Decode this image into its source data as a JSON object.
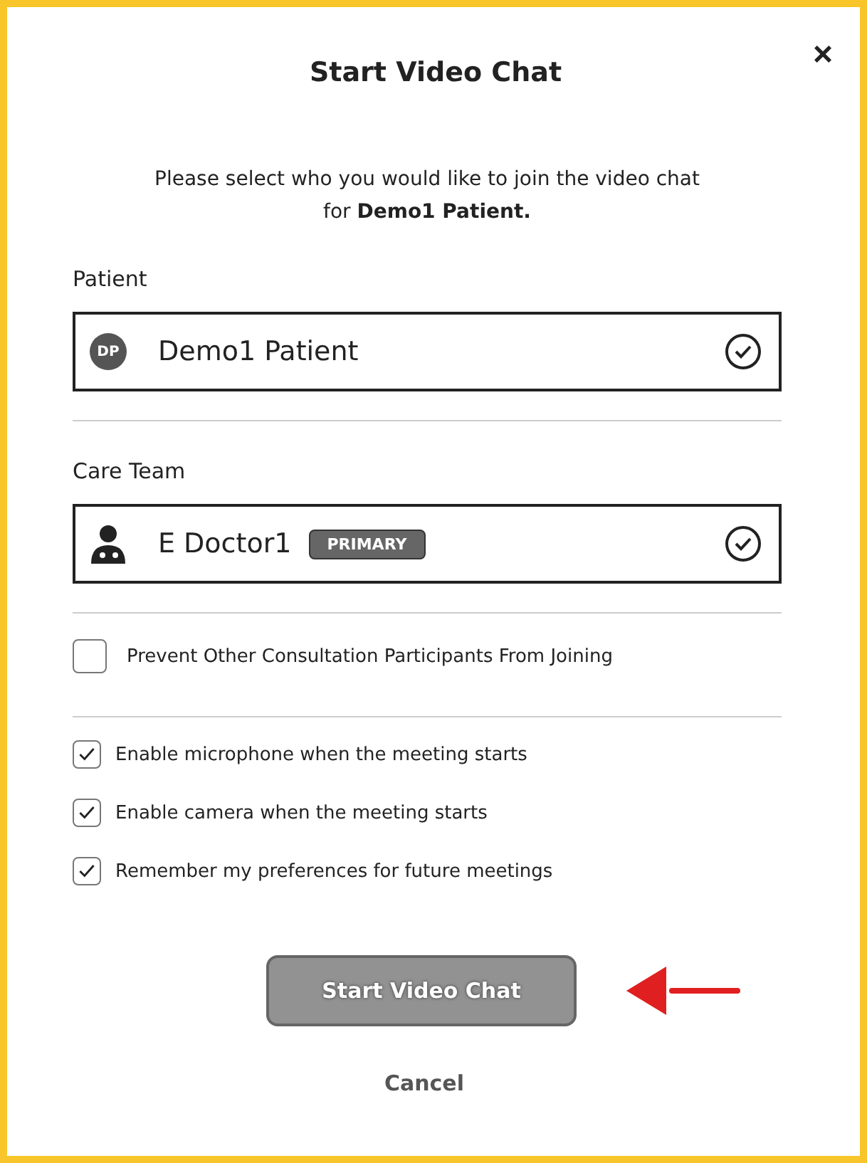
{
  "dialog": {
    "title": "Start Video Chat",
    "close": "×"
  },
  "intro": "Please select who you would like to join the video chat for **Demo1 Patient.**",
  "patient": {
    "label": "Patient",
    "initials": "DP",
    "name": "Demo1 Patient",
    "selected": true
  },
  "care_team": {
    "label": "Care Team",
    "name": "E Doctor1",
    "badge": "PRIMARY",
    "selected": true
  },
  "prevent": {
    "label": "Prevent Other Consultation Participants From Joining",
    "checked": false
  },
  "options": [
    {
      "label": "Enable microphone when the meeting starts",
      "checked": true
    },
    {
      "label": "Enable camera when the meeting starts",
      "checked": true
    },
    {
      "label": "Remember my preferences for future meetings",
      "checked": true
    }
  ],
  "buttons": {
    "start": "Start Video Chat",
    "cancel": "Cancel"
  }
}
